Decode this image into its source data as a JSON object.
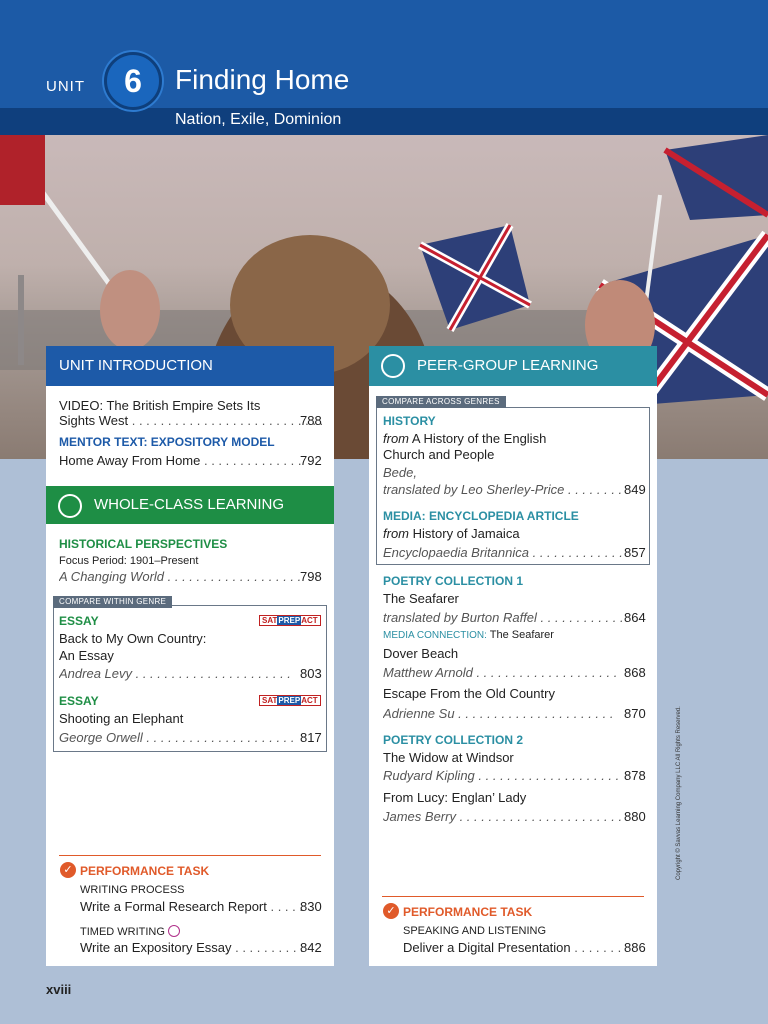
{
  "header": {
    "unit_label": "UNIT",
    "unit_number": "6",
    "title": "Finding Home",
    "subtitle": "Nation, Exile, Dominion"
  },
  "left": {
    "intro_title": "UNIT INTRODUCTION",
    "video_prefix": "VIDEO:",
    "video_title_1": "The British Empire Sets Its",
    "video_title_2": "Sights West",
    "video_page": "788",
    "mentor_label": "MENTOR TEXT: EXPOSITORY MODEL",
    "mentor_title": "Home Away From Home",
    "mentor_page": "792",
    "wcl_title": "WHOLE-CLASS LEARNING",
    "hist_label": "HISTORICAL PERSPECTIVES",
    "focus": "Focus Period: 1901–Present",
    "changing": "A Changing World",
    "changing_page": "798",
    "compare_tag": "COMPARE WITHIN GENRE",
    "essay1_label": "ESSAY",
    "essay1_t1": "Back to My Own Country:",
    "essay1_t2": "An Essay",
    "essay1_author": "Andrea Levy",
    "essay1_page": "803",
    "essay2_label": "ESSAY",
    "essay2_title": "Shooting an Elephant",
    "essay2_author": "George Orwell",
    "essay2_page": "817",
    "sat": {
      "a": "SAT",
      "b": "PREP",
      "c": "ACT"
    },
    "perf_title": "PERFORMANCE TASK",
    "wp_label": "WRITING PROCESS",
    "wp_title": "Write a Formal Research Report",
    "wp_page": "830",
    "tw_label": "TIMED WRITING",
    "tw_title": "Write an Expository Essay",
    "tw_page": "842"
  },
  "right": {
    "pgl_title": "PEER-GROUP LEARNING",
    "compare_tag": "COMPARE ACROSS GENRES",
    "history_label": "HISTORY",
    "hist_from": "from",
    "hist_t1": "A History of the English",
    "hist_t2": "Church and People",
    "hist_author": "Bede,",
    "hist_trans": "translated by Leo Sherley-Price",
    "hist_page": "849",
    "media_label": "MEDIA: ENCYCLOPEDIA ARTICLE",
    "media_from": "from",
    "media_title": "History of Jamaica",
    "media_source": "Encyclopaedia Britannica",
    "media_page": "857",
    "pc1_label": "POETRY COLLECTION 1",
    "seafarer": "The Seafarer",
    "seafarer_trans": "translated by Burton Raffel",
    "seafarer_page": "864",
    "mc_label": "MEDIA CONNECTION:",
    "mc_title": "The Seafarer",
    "dover": "Dover Beach",
    "dover_author": "Matthew Arnold",
    "dover_page": "868",
    "escape": "Escape From the Old Country",
    "escape_author": "Adrienne Su",
    "escape_page": "870",
    "pc2_label": "POETRY COLLECTION 2",
    "widow": "The Widow at Windsor",
    "widow_author": "Rudyard Kipling",
    "widow_page": "878",
    "lucy": "From Lucy: Englan’ Lady",
    "lucy_author": "James Berry",
    "lucy_page": "880",
    "perf_title": "PERFORMANCE TASK",
    "sl_label": "SPEAKING AND LISTENING",
    "sl_title": "Deliver a Digital Presentation",
    "sl_page": "886"
  },
  "footer": {
    "page": "xviii",
    "copyright": "Copyright © Savvas Learning Company LLC All Rights Reserved."
  },
  "colors": {
    "blue": "#1d5aa8",
    "green": "#1e8e45",
    "teal": "#2b8fa3",
    "orange": "#e05a2a"
  }
}
